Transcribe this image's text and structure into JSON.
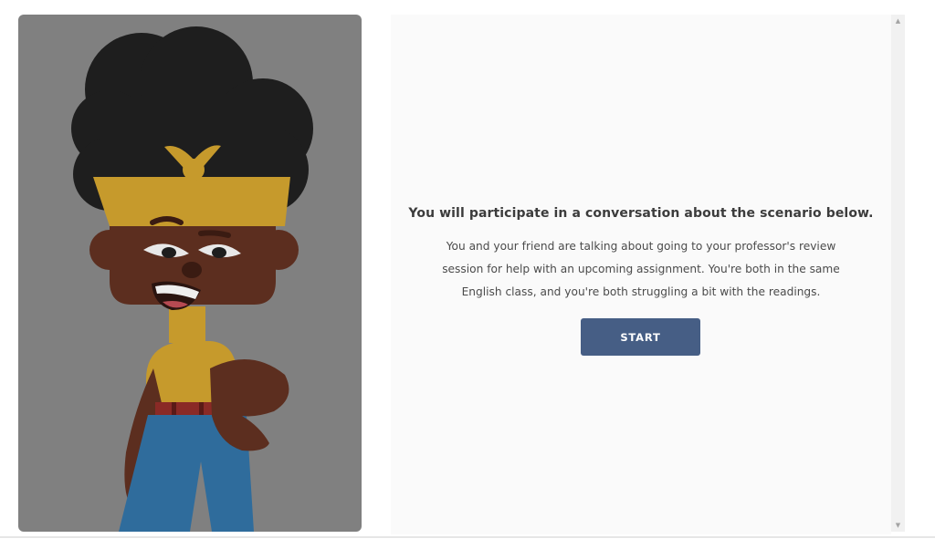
{
  "illustration": {
    "subject": "cartoon character with afro hair, yellow headband, smirking face, yellow top, blue jeans",
    "colors": {
      "panel_background": "#808080",
      "hair": "#1e1e1e",
      "skin": "#5c2e1f",
      "headband_and_top": "#c69a2c",
      "jeans": "#2f6c9c",
      "belt": "#8a2a26"
    }
  },
  "scenario": {
    "heading": "You will participate in a conversation about the scenario below.",
    "lines": [
      "You and your friend are talking about going to your professor's review",
      "session for help with an upcoming assignment. You're both in the same",
      "English class, and you're both struggling a bit with the readings."
    ],
    "start_label": "START"
  },
  "scrollbar": {
    "up_icon": "▲",
    "down_icon": "▼"
  },
  "colors": {
    "button": "#465e85",
    "panel": "#fafafa"
  }
}
